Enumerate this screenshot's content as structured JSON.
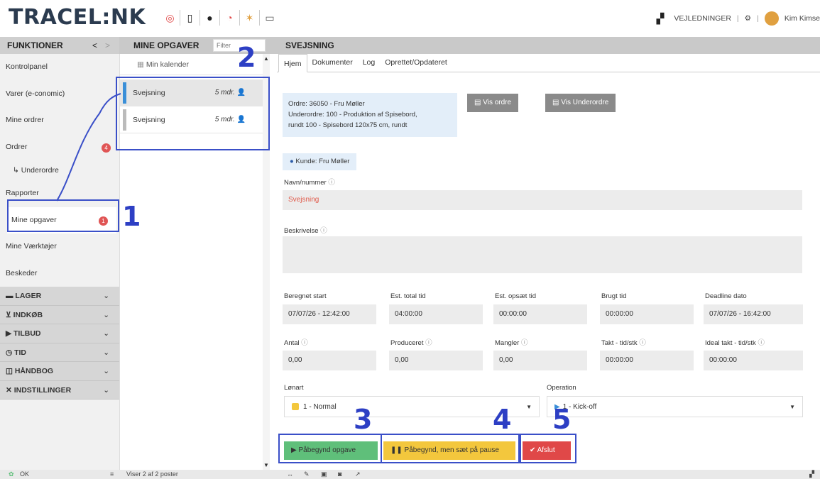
{
  "app": {
    "logo": "TRACEL:NK"
  },
  "topbar": {
    "icons": [
      "lifebuoy-icon",
      "phone-icon",
      "chat-icon",
      "timer-icon",
      "analytics-icon",
      "keyboard-icon"
    ],
    "guides": "VEJLEDNINGER",
    "separator": "|",
    "user": "Kim Kimse"
  },
  "sidebar": {
    "header": "FUNKTIONER",
    "items": [
      {
        "label": "Kontrolpanel"
      },
      {
        "label": "Varer (e-conomic)"
      },
      {
        "label": "Mine ordrer"
      },
      {
        "label": "Ordrer",
        "badge": "4"
      },
      {
        "label": "↳ Underordre"
      },
      {
        "label": "Rapporter"
      },
      {
        "label": "Mine opgaver",
        "badge": "1"
      },
      {
        "label": "Mine Værktøjer"
      },
      {
        "label": "Beskeder"
      }
    ],
    "groups": [
      "LAGER",
      "INDKØB",
      "TILBUD",
      "TID",
      "HÅNDBOG",
      "INDSTILLINGER"
    ]
  },
  "tasks": {
    "header": "MINE OPGAVER",
    "filter_placeholder": "Filter",
    "calendar": "Min kalender",
    "rows": [
      {
        "name": "Svejsning",
        "time": "5 mdr."
      },
      {
        "name": "Svejsning",
        "time": "5 mdr."
      }
    ],
    "footer": "Viser 2 af 2 poster"
  },
  "detail": {
    "header": "SVEJSNING",
    "tabs": [
      "Hjem",
      "Dokumenter",
      "Log",
      "Oprettet/Opdateret"
    ],
    "order_line1": "Ordre: 36050 - Fru Møller",
    "order_line2": "Underordre: 100 - Produktion af Spisebord,",
    "order_line3": "rundt 100 - Spisebord 120x75 cm, rundt",
    "btn_vis_ordre": "Vis ordre",
    "btn_vis_underordre": "Vis Underordre",
    "kunde": "Kunde: Fru Møller",
    "navn_label": "Navn/nummer",
    "navn_value": "Svejsning",
    "beskrivelse_label": "Beskrivelse",
    "row1": [
      {
        "label": "Beregnet start",
        "value": "07/07/26 - 12:42:00"
      },
      {
        "label": "Est. total tid",
        "value": "04:00:00"
      },
      {
        "label": "Est. opsæt tid",
        "value": "00:00:00"
      },
      {
        "label": "Brugt tid",
        "value": "00:00:00"
      },
      {
        "label": "Deadline dato",
        "value": "07/07/26 - 16:42:00"
      }
    ],
    "row2": [
      {
        "label": "Antal",
        "value": "0,00"
      },
      {
        "label": "Produceret",
        "value": "0,00"
      },
      {
        "label": "Mangler",
        "value": "0,00"
      },
      {
        "label": "Takt - tid/stk",
        "value": "00:00:00"
      },
      {
        "label": "Ideal takt - tid/stk",
        "value": "00:00:00"
      }
    ],
    "lonart_label": "Lønart",
    "lonart_value": "1 - Normal",
    "operation_label": "Operation",
    "operation_value": "1 - Kick-off",
    "btn_start": "Påbegynd opgave",
    "btn_pause": "Påbegynd, men sæt på pause",
    "btn_finish": "Afslut"
  },
  "status": {
    "ok": "OK"
  },
  "callouts": [
    "1",
    "2",
    "3",
    "4",
    "5"
  ],
  "colors": {
    "accent": "#3a4fc8",
    "green": "#5fbf7a",
    "yellow": "#f3c73d",
    "red": "#e04848"
  }
}
